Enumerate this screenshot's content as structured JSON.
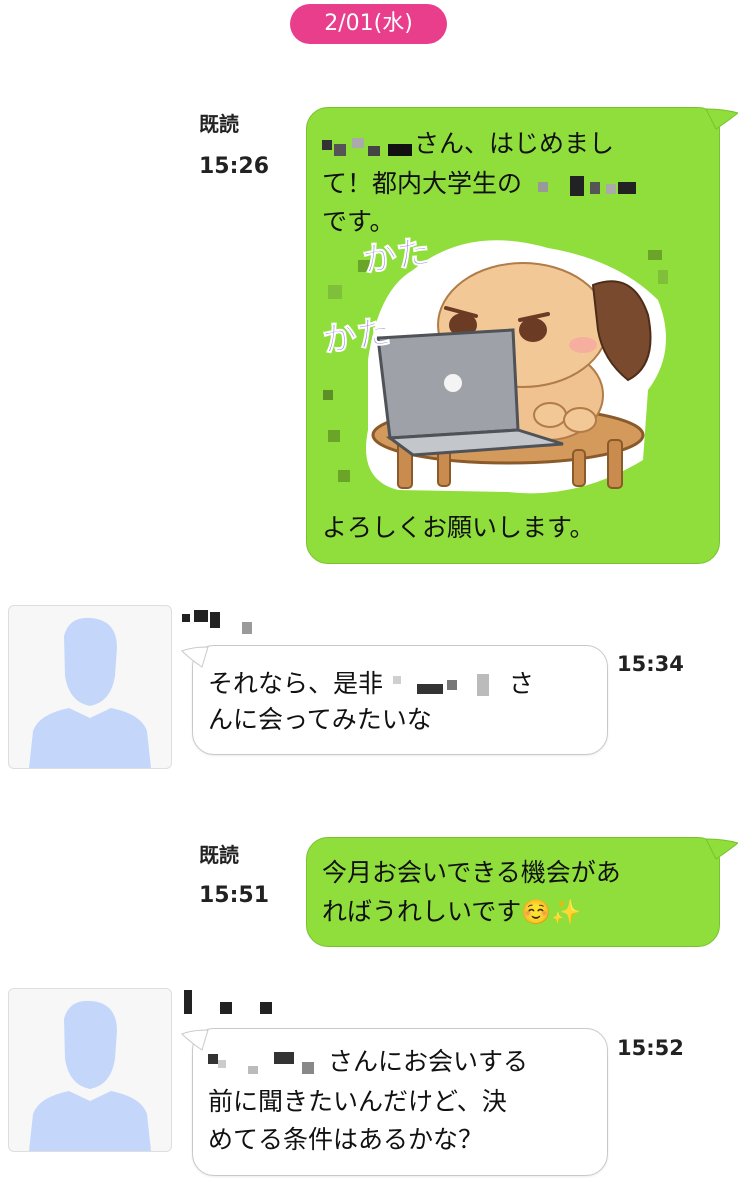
{
  "date_separator": "2/01(水)",
  "messages": [
    {
      "direction": "out",
      "read_label": "既読",
      "time": "15:26",
      "line1": "さん、はじめまし",
      "line2_prefix": "て！都内大学生の",
      "line3": "です。",
      "sticker_text_top": "かた",
      "sticker_text_bottom": "かた",
      "sticker_icon": "dog-typing-laptop-sticker",
      "last_line": "よろしくお願いします。"
    },
    {
      "direction": "in",
      "time": "15:34",
      "line1_prefix": "それなら、是非",
      "line1_suffix": "さ",
      "line2": "んに会ってみたいな"
    },
    {
      "direction": "out",
      "read_label": "既読",
      "time": "15:51",
      "line1": "今月お会いできる機会があ",
      "line2": "ればうれしいです",
      "emoji": "☺️✨"
    },
    {
      "direction": "in",
      "time": "15:52",
      "line1_suffix": "さんにお会いする",
      "line2": "前に聞きたいんだけど、決",
      "line3": "めてる条件はあるかな？"
    }
  ],
  "colors": {
    "outgoing_bubble": "#8fde3b",
    "incoming_bubble": "#ffffff",
    "date_pill": "#e83e8c",
    "avatar_silhouette": "#c4d7fb"
  }
}
